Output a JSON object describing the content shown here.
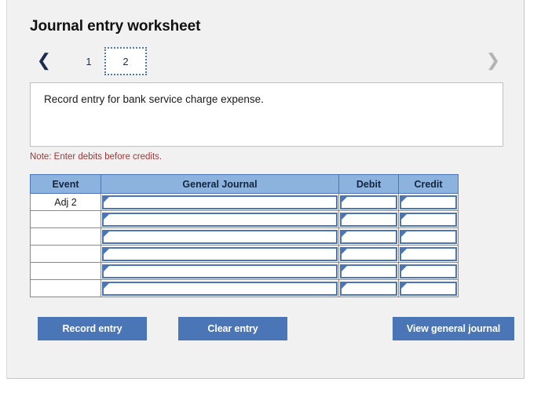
{
  "header": {
    "title": "Journal entry worksheet"
  },
  "pager": {
    "prev_icon": "chevron-left-icon",
    "next_icon": "chevron-right-icon",
    "pages": [
      {
        "label": "1",
        "active": false
      },
      {
        "label": "2",
        "active": true
      }
    ]
  },
  "description": {
    "text": "Record entry for bank service charge expense."
  },
  "note": {
    "text": "Note: Enter debits before credits."
  },
  "table": {
    "headers": {
      "event": "Event",
      "general_journal": "General Journal",
      "debit": "Debit",
      "credit": "Credit"
    },
    "rows": [
      {
        "event": "Adj 2",
        "general_journal": "",
        "debit": "",
        "credit": ""
      },
      {
        "event": "",
        "general_journal": "",
        "debit": "",
        "credit": ""
      },
      {
        "event": "",
        "general_journal": "",
        "debit": "",
        "credit": ""
      },
      {
        "event": "",
        "general_journal": "",
        "debit": "",
        "credit": ""
      },
      {
        "event": "",
        "general_journal": "",
        "debit": "",
        "credit": ""
      },
      {
        "event": "",
        "general_journal": "",
        "debit": "",
        "credit": ""
      }
    ]
  },
  "buttons": {
    "record": "Record entry",
    "clear": "Clear entry",
    "view": "View general journal"
  },
  "colors": {
    "accent": "#4a76b8",
    "header_fill": "#8cb3de",
    "note": "#9e3737",
    "panel_bg": "#f1f1f1"
  }
}
